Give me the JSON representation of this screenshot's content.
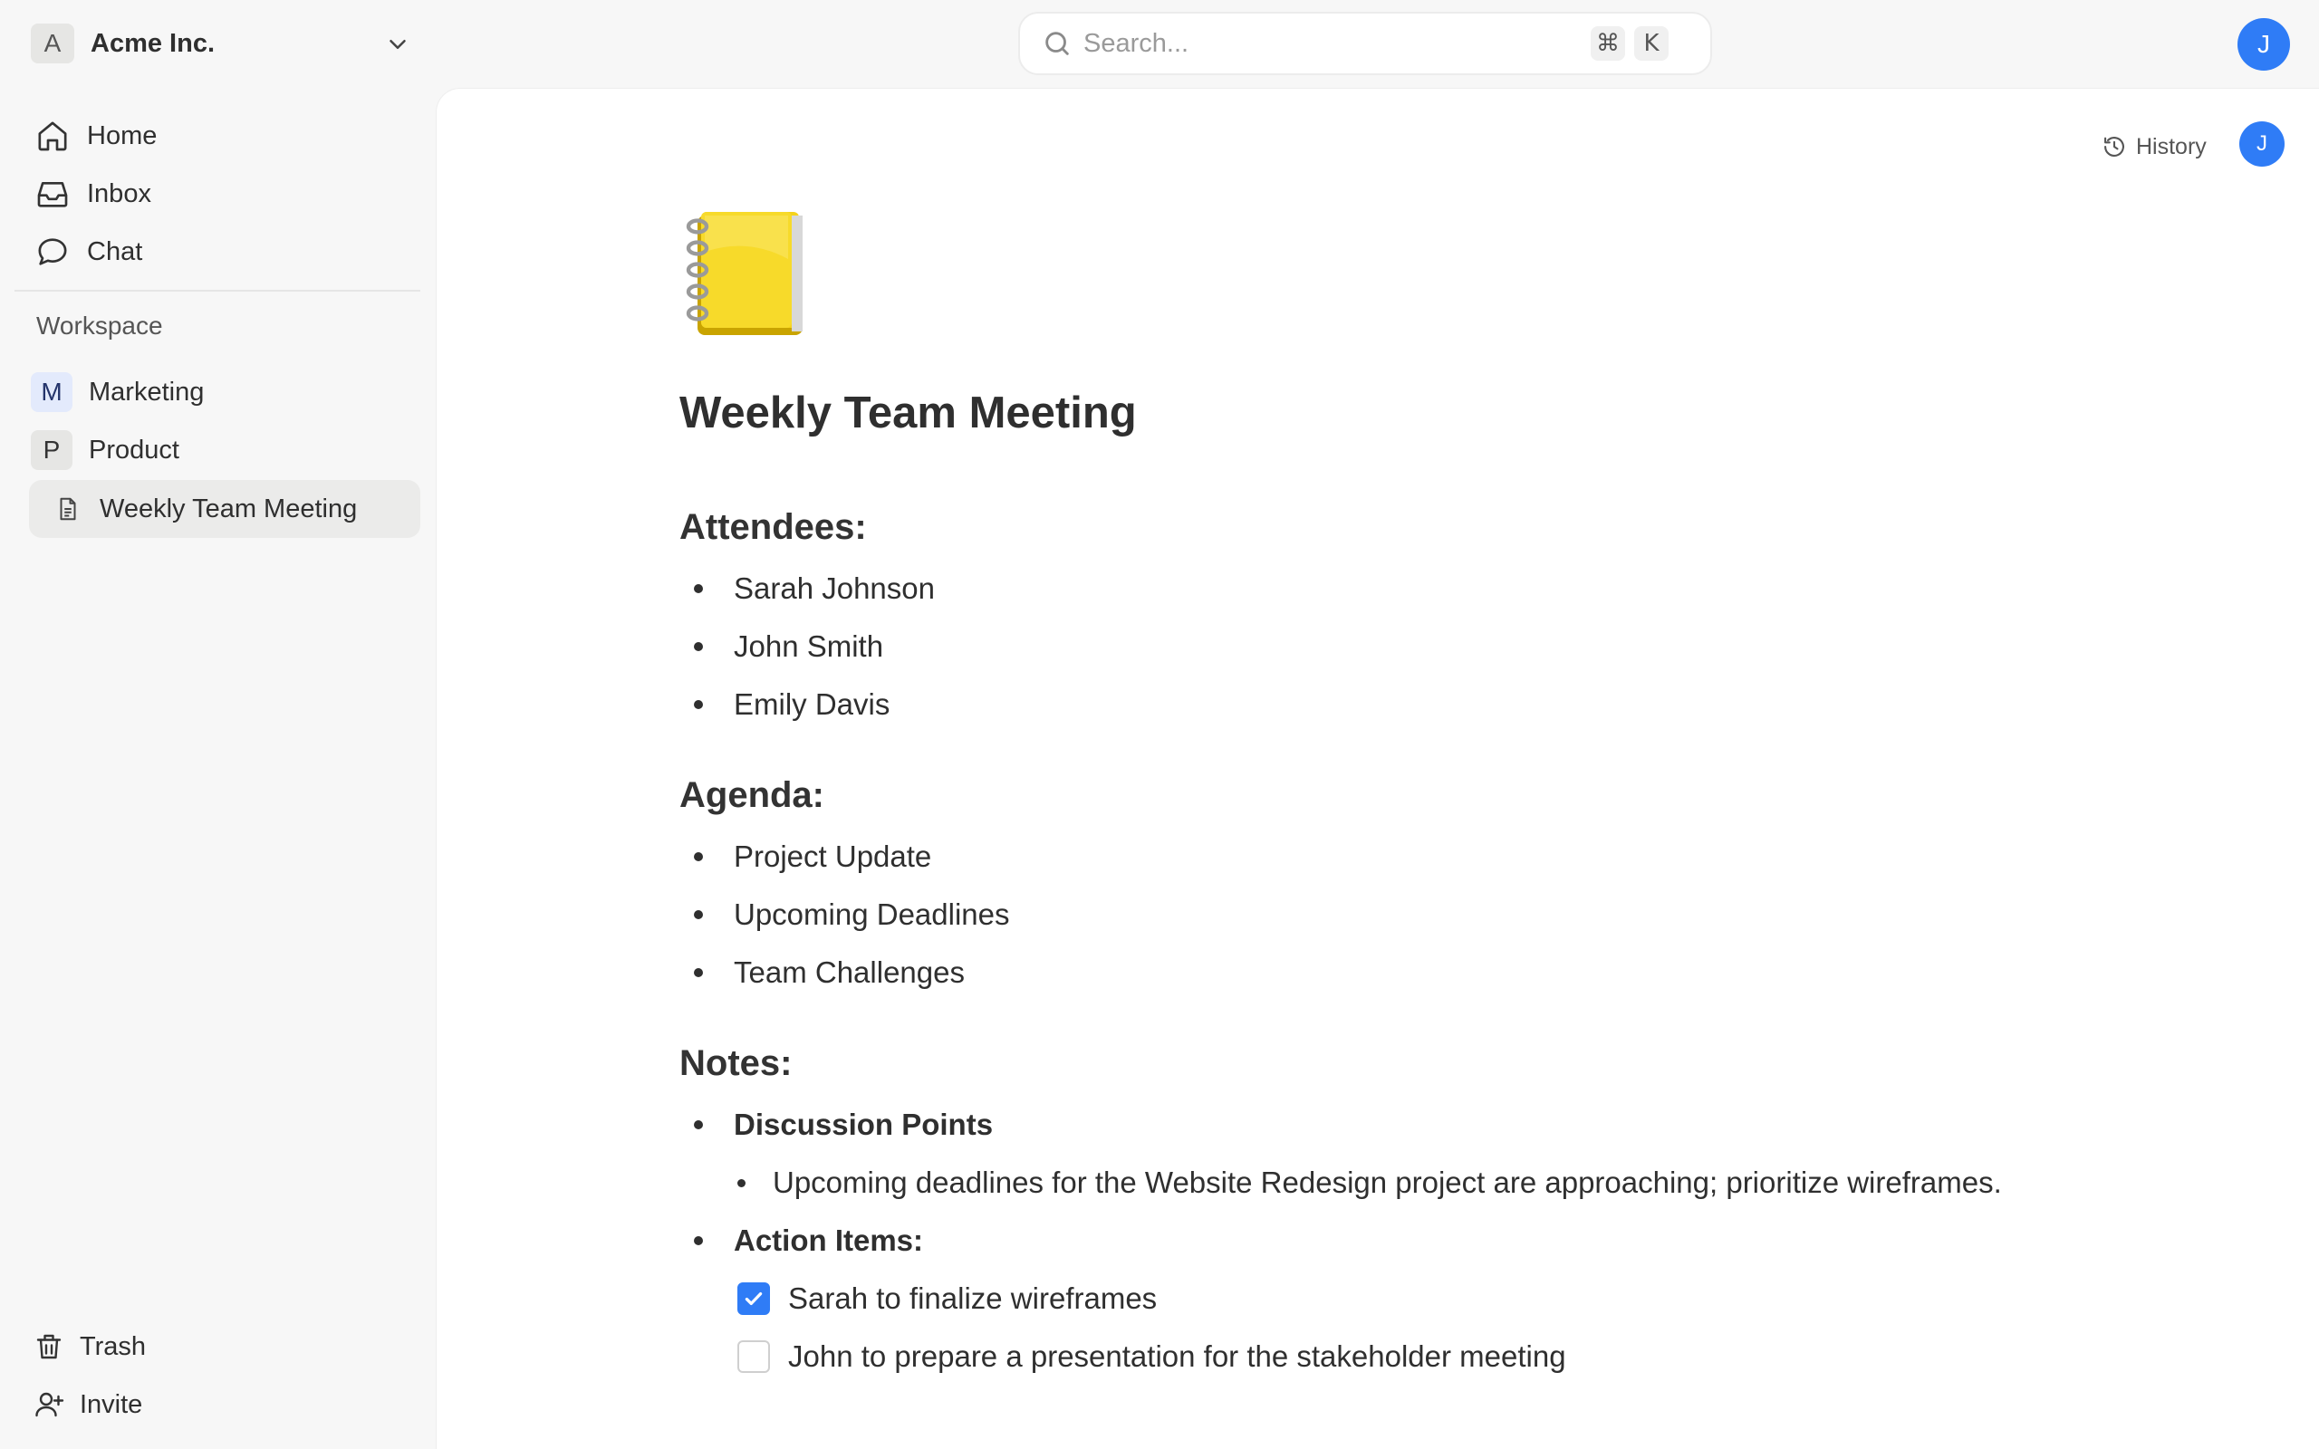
{
  "org": {
    "badge": "A",
    "name": "Acme Inc."
  },
  "search": {
    "placeholder": "Search...",
    "shortcut_mod": "⌘",
    "shortcut_key": "K"
  },
  "user": {
    "initial": "J"
  },
  "sidebar": {
    "nav": [
      {
        "label": "Home",
        "icon": "home-icon"
      },
      {
        "label": "Inbox",
        "icon": "inbox-icon"
      },
      {
        "label": "Chat",
        "icon": "chat-bubble-icon"
      }
    ],
    "section_label": "Workspace",
    "workspaces": [
      {
        "badge": "M",
        "label": "Marketing"
      },
      {
        "badge": "P",
        "label": "Product"
      }
    ],
    "active_page": {
      "label": "Weekly Team Meeting",
      "icon": "document-icon"
    },
    "bottom": [
      {
        "label": "Trash",
        "icon": "trash-icon"
      },
      {
        "label": "Invite",
        "icon": "add-user-icon"
      }
    ]
  },
  "doc_header": {
    "history_label": "History",
    "avatar_initial": "J"
  },
  "doc": {
    "icon": "notebook-icon",
    "title": "Weekly Team Meeting",
    "attendees_heading": "Attendees:",
    "attendees": [
      "Sarah Johnson",
      "John Smith",
      "Emily Davis"
    ],
    "agenda_heading": "Agenda:",
    "agenda": [
      "Project Update",
      "Upcoming Deadlines",
      "Team Challenges"
    ],
    "notes_heading": "Notes:",
    "discussion_heading": "Discussion Points",
    "discussion_points": [
      "Upcoming deadlines for the Website Redesign project are approaching; prioritize wireframes."
    ],
    "action_items_heading": "Action Items:",
    "action_items": [
      {
        "text": "Sarah to finalize wireframes",
        "checked": true
      },
      {
        "text": "John to prepare a presentation for the stakeholder meeting",
        "checked": false
      }
    ]
  },
  "colors": {
    "accent": "#2f7cf6",
    "sidebar_bg": "#f7f7f7",
    "active_item_bg": "#ebebea",
    "text": "#2f2f2f"
  }
}
